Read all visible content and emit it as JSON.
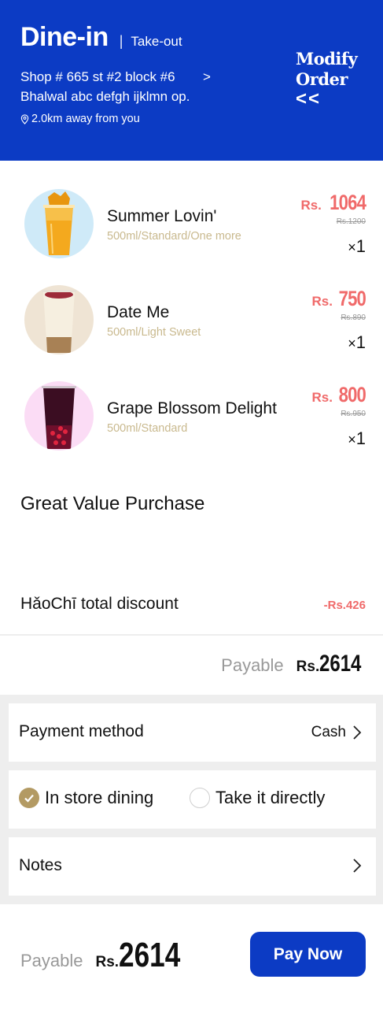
{
  "header": {
    "mode_active": "Dine-in",
    "separator": "|",
    "mode_other": "Take-out",
    "shop_address": "Shop # 665 st #2 block #6 Bhalwal abc defgh ijklmn op.",
    "shop_chevron": ">",
    "distance": "2.0km away from you",
    "modify_line1": "Modify",
    "modify_line2": "Order",
    "modify_arrows": "<<",
    "brand_color": "#0c3bc4"
  },
  "items": [
    {
      "name": "Summer Lovin'",
      "spec": "500ml/Standard/One more",
      "currency": "Rs.",
      "price": "1064",
      "original": "Rs.1200",
      "qty_prefix": "×",
      "qty": "1"
    },
    {
      "name": "Date Me",
      "spec": "500ml/Light Sweet",
      "currency": "Rs.",
      "price": "750",
      "original": "Rs.890",
      "qty_prefix": "×",
      "qty": "1"
    },
    {
      "name": "Grape Blossom Delight",
      "spec": "500ml/Standard",
      "currency": "Rs.",
      "price": "800",
      "original": "Rs.950",
      "qty_prefix": "×",
      "qty": "1"
    }
  ],
  "section_title": "Great Value Purchase",
  "discount": {
    "label": "HǎoChī total discount",
    "value": "-Rs.426"
  },
  "summary": {
    "label": "Payable",
    "currency": "Rs.",
    "amount": "2614"
  },
  "payment": {
    "label": "Payment method",
    "value": "Cash"
  },
  "dining": {
    "option1": "In store dining",
    "option2": "Take it directly",
    "selected": "In store dining"
  },
  "notes": {
    "label": "Notes"
  },
  "footer": {
    "label": "Payable",
    "currency": "Rs.",
    "amount": "2614",
    "button": "Pay Now"
  },
  "colors": {
    "accent": "#0c3bc4",
    "price": "#f06a6a",
    "spec": "#c9b98e",
    "radio_checked": "#b39a63"
  }
}
